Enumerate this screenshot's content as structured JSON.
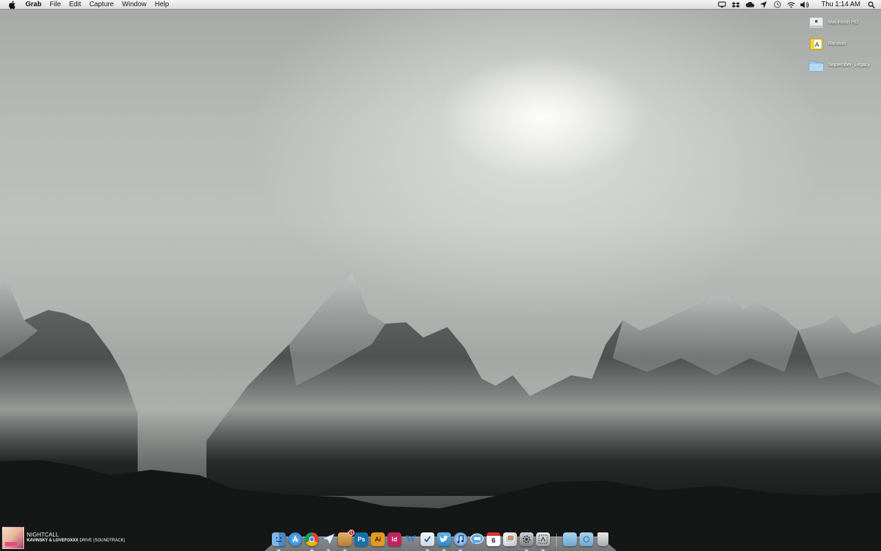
{
  "menubar": {
    "app_name": "Grab",
    "menus": [
      "File",
      "Edit",
      "Capture",
      "Window",
      "Help"
    ],
    "clock": "Thu 1:14 AM"
  },
  "desktop_icons": [
    {
      "label": "Macintosh HD",
      "icon": "hard-drive-icon"
    },
    {
      "label": "Random",
      "icon": "document-icon"
    },
    {
      "label": "September_Legacy",
      "icon": "folder-icon"
    }
  ],
  "now_playing": {
    "title": "NIGHTCALL",
    "artist": "KAVINSKY & LOVEFOXXX",
    "album": "DRIVE (SOUNDTRACK)"
  },
  "dock": {
    "apps": [
      {
        "name": "finder",
        "text": ""
      },
      {
        "name": "app-store",
        "text": ""
      },
      {
        "name": "chrome",
        "text": ""
      },
      {
        "name": "sparrow",
        "text": ""
      },
      {
        "name": "package",
        "text": ""
      },
      {
        "name": "photoshop",
        "text": "Ps"
      },
      {
        "name": "illustrator",
        "text": "Ai"
      },
      {
        "name": "indesign",
        "text": "Id"
      },
      {
        "name": "word",
        "text": "W"
      },
      {
        "name": "tasks",
        "text": ""
      },
      {
        "name": "twitter",
        "text": ""
      },
      {
        "name": "itunes",
        "text": ""
      },
      {
        "name": "facetime",
        "text": ""
      },
      {
        "name": "calendar",
        "text": "6"
      },
      {
        "name": "preview",
        "text": ""
      },
      {
        "name": "system-preferences",
        "text": ""
      },
      {
        "name": "grab",
        "text": ""
      }
    ],
    "badge_count": "1"
  },
  "colors": {
    "menubar_bg": "#e8e8e8",
    "photoshop": "#1b6fa8",
    "illustrator": "#e39a1d",
    "indesign": "#c3245d",
    "word": "#2a7fcf",
    "twitter": "#3b9ad9"
  }
}
